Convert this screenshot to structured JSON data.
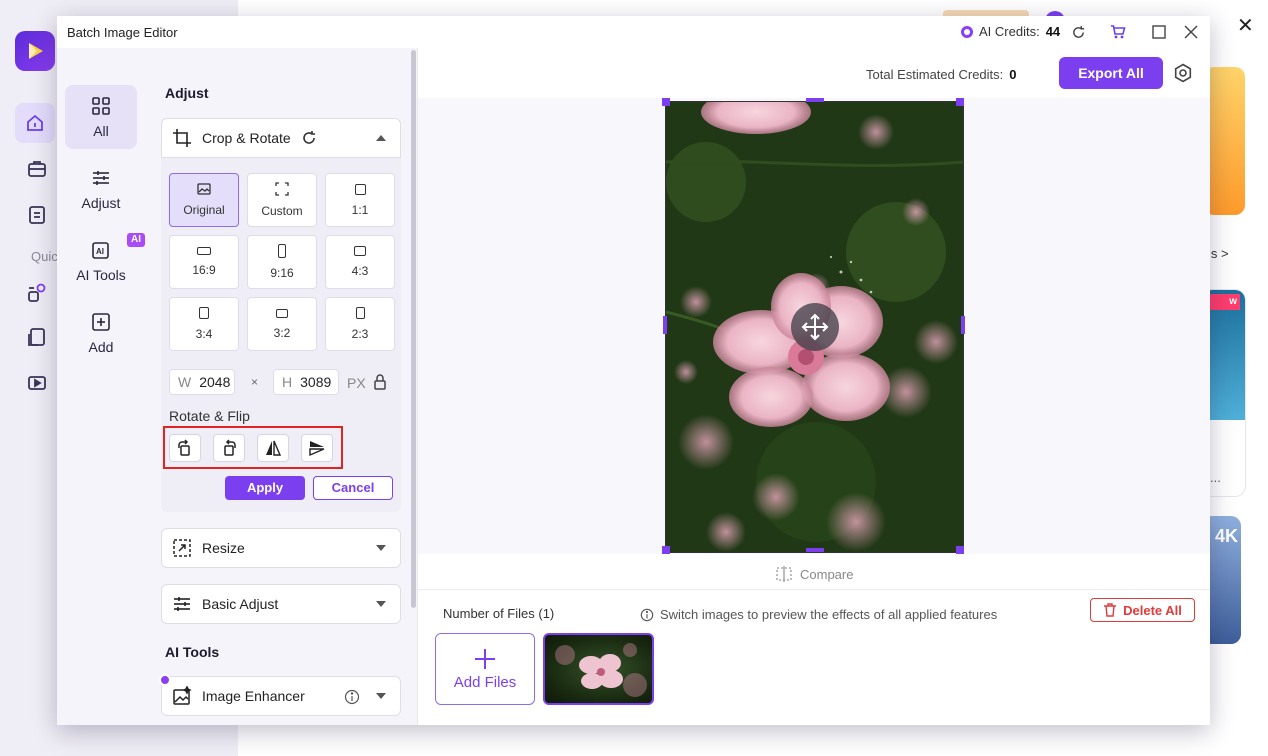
{
  "background_app": {
    "quick_label": "Quic",
    "tools_link": "ls >",
    "card2_tag": "w",
    "card2_ellipsis": "...",
    "card3_label": "4K"
  },
  "dialog": {
    "title": "Batch Image Editor",
    "credits_label": "AI Credits:",
    "credits_value": "44"
  },
  "leftnav": {
    "items": [
      {
        "label": "All",
        "icon": "grid-icon"
      },
      {
        "label": "Adjust",
        "icon": "sliders-icon"
      },
      {
        "label": "AI Tools",
        "icon": "ai-icon",
        "badge": "AI"
      },
      {
        "label": "Add",
        "icon": "plus-square-icon"
      }
    ]
  },
  "panel": {
    "adjust_heading": "Adjust",
    "crop_rotate_label": "Crop & Rotate",
    "ratios": [
      "Original",
      "Custom",
      "1:1",
      "16:9",
      "9:16",
      "4:3",
      "3:4",
      "3:2",
      "2:3"
    ],
    "width_label": "W",
    "width_value": "2048",
    "times": "×",
    "height_label": "H",
    "height_value": "3089",
    "unit": "PX",
    "rotate_flip_label": "Rotate & Flip",
    "apply_label": "Apply",
    "cancel_label": "Cancel",
    "resize_label": "Resize",
    "basic_adjust_label": "Basic Adjust",
    "ai_tools_heading": "AI Tools",
    "image_enhancer_label": "Image Enhancer"
  },
  "main": {
    "est_label": "Total Estimated Credits:",
    "est_value": "0",
    "export_label": "Export All",
    "compare_label": "Compare",
    "files_count_label": "Number of Files (1)",
    "hint": "Switch images to preview the effects of all applied features",
    "delete_label": "Delete All",
    "add_files_label": "Add Files"
  },
  "colors": {
    "accent": "#7b3ff0",
    "danger": "#e03b3b",
    "highlight_box": "#e02424"
  }
}
